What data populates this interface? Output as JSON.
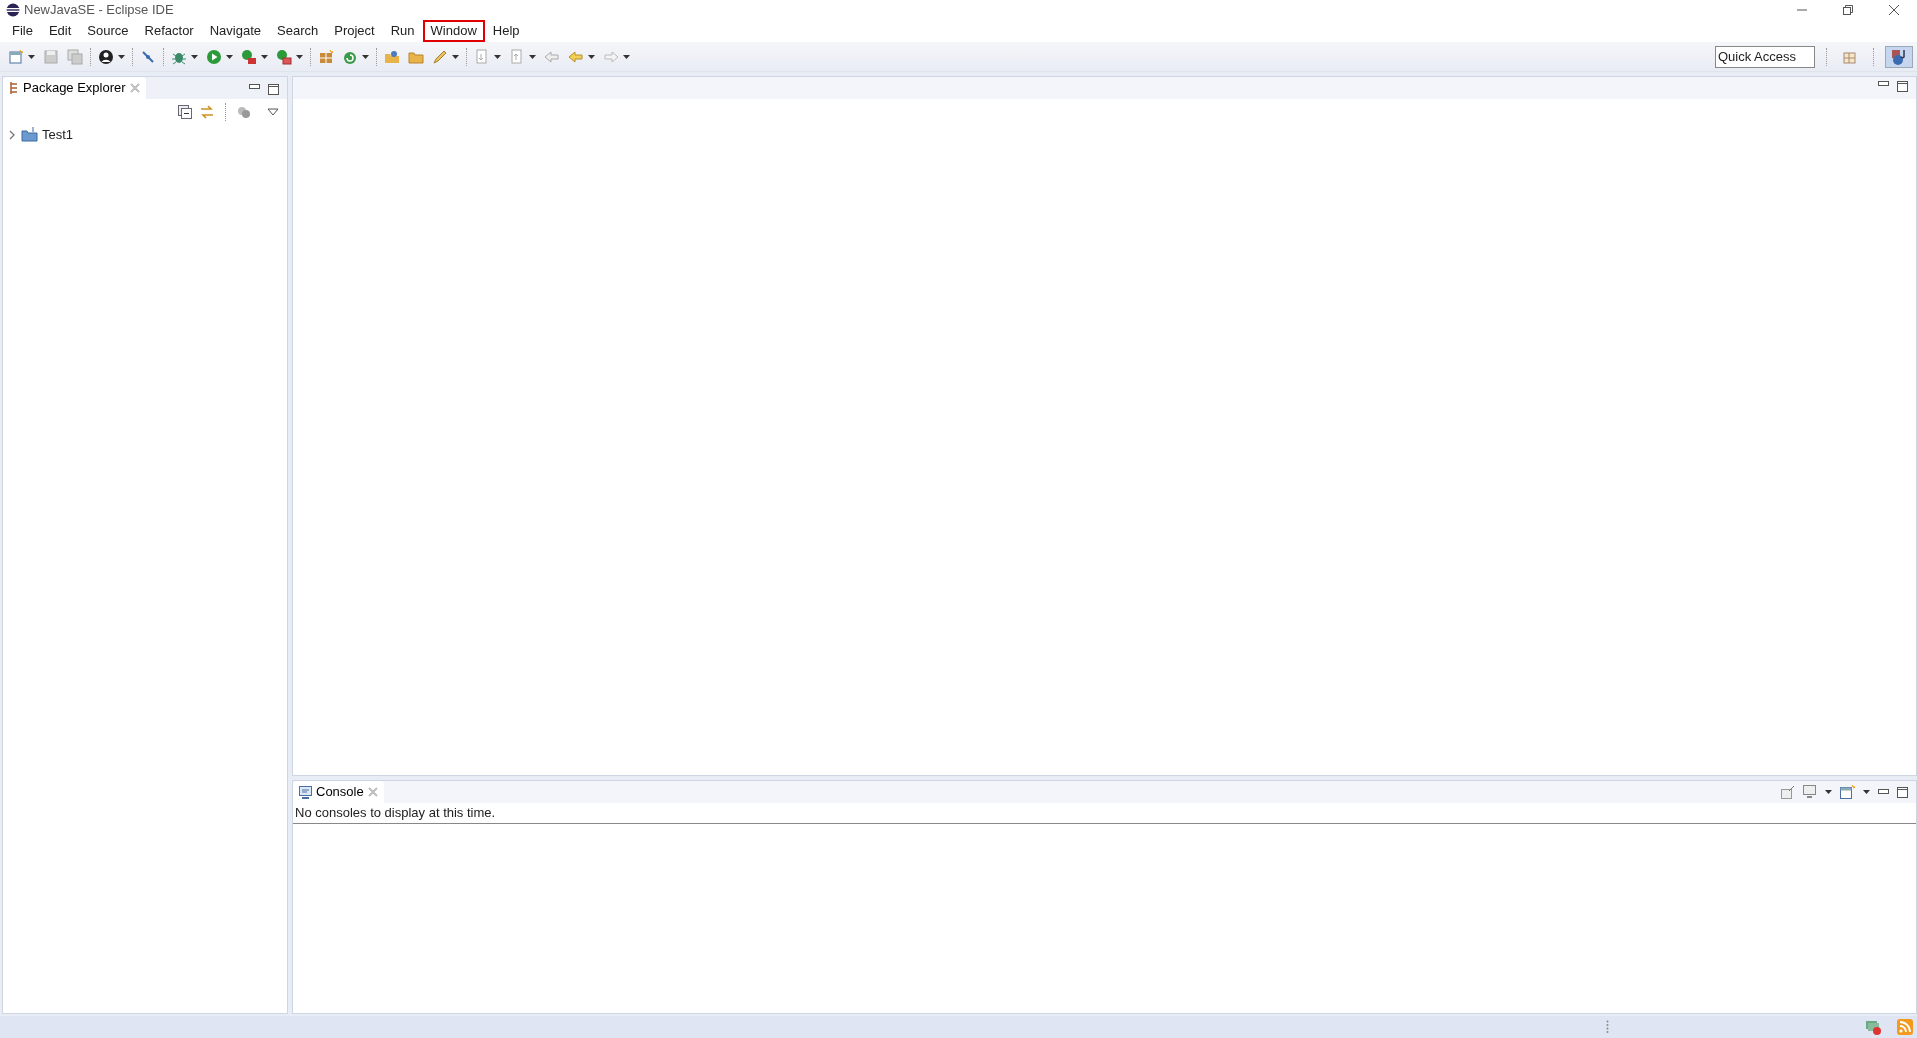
{
  "window": {
    "title": "NewJavaSE - Eclipse IDE"
  },
  "menu": [
    {
      "label": "File",
      "highlighted": false
    },
    {
      "label": "Edit",
      "highlighted": false
    },
    {
      "label": "Source",
      "highlighted": false
    },
    {
      "label": "Refactor",
      "highlighted": false
    },
    {
      "label": "Navigate",
      "highlighted": false
    },
    {
      "label": "Search",
      "highlighted": false
    },
    {
      "label": "Project",
      "highlighted": false
    },
    {
      "label": "Run",
      "highlighted": false
    },
    {
      "label": "Window",
      "highlighted": true
    },
    {
      "label": "Help",
      "highlighted": false
    }
  ],
  "quick_access": {
    "placeholder": "Quick Access"
  },
  "package_explorer": {
    "tab": {
      "label": "Package Explorer",
      "selected": true
    },
    "tree": [
      {
        "label": "Test1",
        "expanded": false
      }
    ]
  },
  "console": {
    "tab": {
      "label": "Console",
      "selected": true
    },
    "message": "No consoles to display at this time."
  }
}
